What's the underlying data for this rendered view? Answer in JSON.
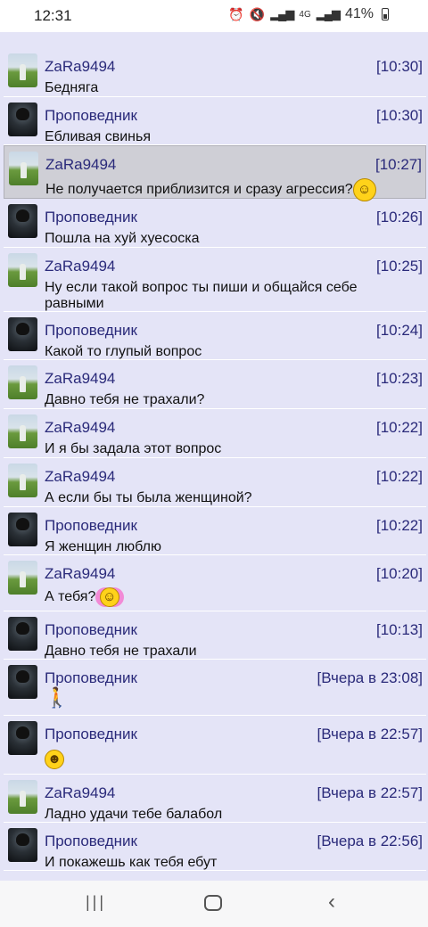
{
  "status": {
    "time": "12:31",
    "network": "4G",
    "battery": "41%"
  },
  "messages": [
    {
      "user": "ZaRa9494",
      "time": "[10:30]",
      "text": "Бедняга"
    },
    {
      "user": "Проповедник",
      "time": "[10:30]",
      "text": "Ебливая свинья"
    },
    {
      "user": "ZaRa9494",
      "time": "[10:27]",
      "text": "Не получается приблизится и сразу агрессия?"
    },
    {
      "user": "Проповедник",
      "time": "[10:26]",
      "text": "Пошла на хуй хуесоска"
    },
    {
      "user": "ZaRa9494",
      "time": "[10:25]",
      "text": "Ну если такой вопрос ты пиши и общайся себе равными"
    },
    {
      "user": "Проповедник",
      "time": "[10:24]",
      "text": "Какой то глупый вопрос"
    },
    {
      "user": "ZaRa9494",
      "time": "[10:23]",
      "text": "Давно тебя не трахали?"
    },
    {
      "user": "ZaRa9494",
      "time": "[10:22]",
      "text": "И я бы задала этот вопрос"
    },
    {
      "user": "ZaRa9494",
      "time": "[10:22]",
      "text": "А если бы ты была женщиной?"
    },
    {
      "user": "Проповедник",
      "time": "[10:22]",
      "text": "Я женщин люблю"
    },
    {
      "user": "ZaRa9494",
      "time": "[10:20]",
      "text": "А тебя?"
    },
    {
      "user": "Проповедник",
      "time": "[10:13]",
      "text": "Давно тебя не трахали"
    },
    {
      "user": "Проповедник",
      "time": "[Вчера в 23:08]",
      "text": ""
    },
    {
      "user": "Проповедник",
      "time": "[Вчера в 22:57]",
      "text": ""
    },
    {
      "user": "ZaRa9494",
      "time": "[Вчера в 22:57]",
      "text": "Ладно удачи тебе балабол"
    },
    {
      "user": "Проповедник",
      "time": "[Вчера в 22:56]",
      "text": "И покажешь как тебя ебут"
    }
  ]
}
